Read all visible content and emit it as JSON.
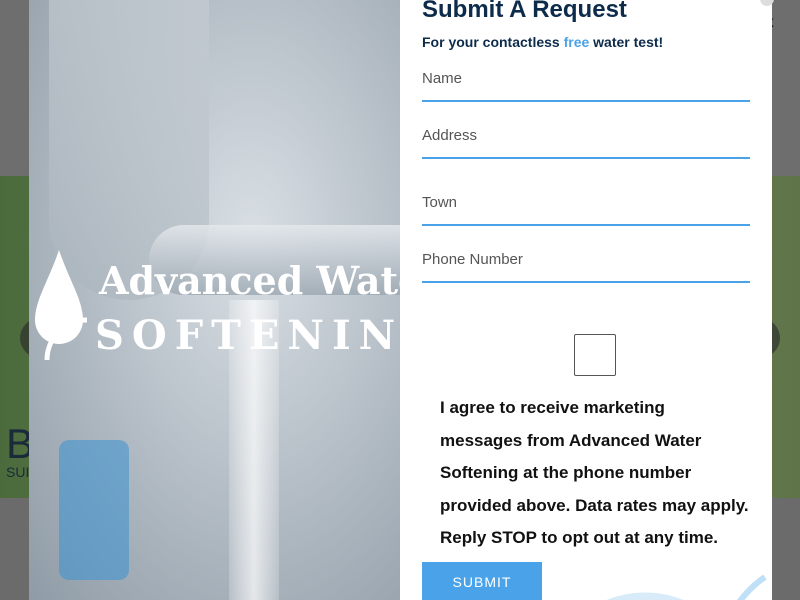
{
  "background": {
    "header_link": "ex",
    "hero_heading": "B",
    "hero_sub": "SUI"
  },
  "modal": {
    "logo": {
      "line1": "Advanced Water",
      "line2": "SOFTENING"
    },
    "form": {
      "title": "Submit A Request",
      "subtitle_prefix": "For your contactless ",
      "subtitle_highlight": "free",
      "subtitle_suffix": " water test!",
      "fields": {
        "name": "Name",
        "address": "Address",
        "town": "Town",
        "phone": "Phone Number"
      },
      "consent": "I agree to receive marketing messages from Advanced Water Softening at the phone number provided above. Data rates may apply. Reply STOP to opt out at any time.",
      "submit_label": "SUBMIT"
    }
  },
  "colors": {
    "accent": "#4aa3e8",
    "title": "#0d2b4a"
  }
}
